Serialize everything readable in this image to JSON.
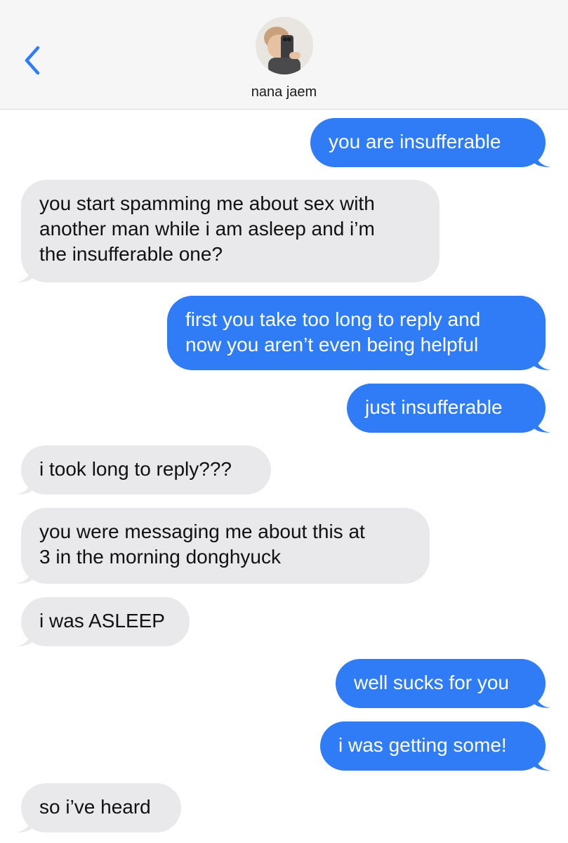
{
  "header": {
    "contact_name": "nana jaem",
    "back_icon": "chevron-left-icon",
    "avatar_icon": "contact-avatar"
  },
  "colors": {
    "outgoing_bubble": "#2f7cf6",
    "incoming_bubble": "#e9e9eb",
    "header_background": "#f6f6f6",
    "accent": "#2f7cf6"
  },
  "messages": [
    {
      "direction": "outgoing",
      "lines": [
        "you are insufferable"
      ]
    },
    {
      "direction": "incoming",
      "lines": [
        "you start spamming me about sex with",
        "another man while i am asleep and i’m",
        "the insufferable one?"
      ]
    },
    {
      "direction": "outgoing",
      "lines": [
        "first you take too long to reply and",
        "now you aren’t even being helpful"
      ]
    },
    {
      "direction": "outgoing",
      "lines": [
        "just insufferable"
      ]
    },
    {
      "direction": "incoming",
      "lines": [
        "i took long to reply???"
      ]
    },
    {
      "direction": "incoming",
      "lines": [
        "you were messaging me about this at",
        "3 in the morning donghyuck"
      ]
    },
    {
      "direction": "incoming",
      "lines": [
        "i was ASLEEP"
      ]
    },
    {
      "direction": "outgoing",
      "lines": [
        "well sucks for you"
      ]
    },
    {
      "direction": "outgoing",
      "lines": [
        "i was getting some!"
      ]
    },
    {
      "direction": "incoming",
      "lines": [
        "so i’ve heard"
      ]
    }
  ]
}
